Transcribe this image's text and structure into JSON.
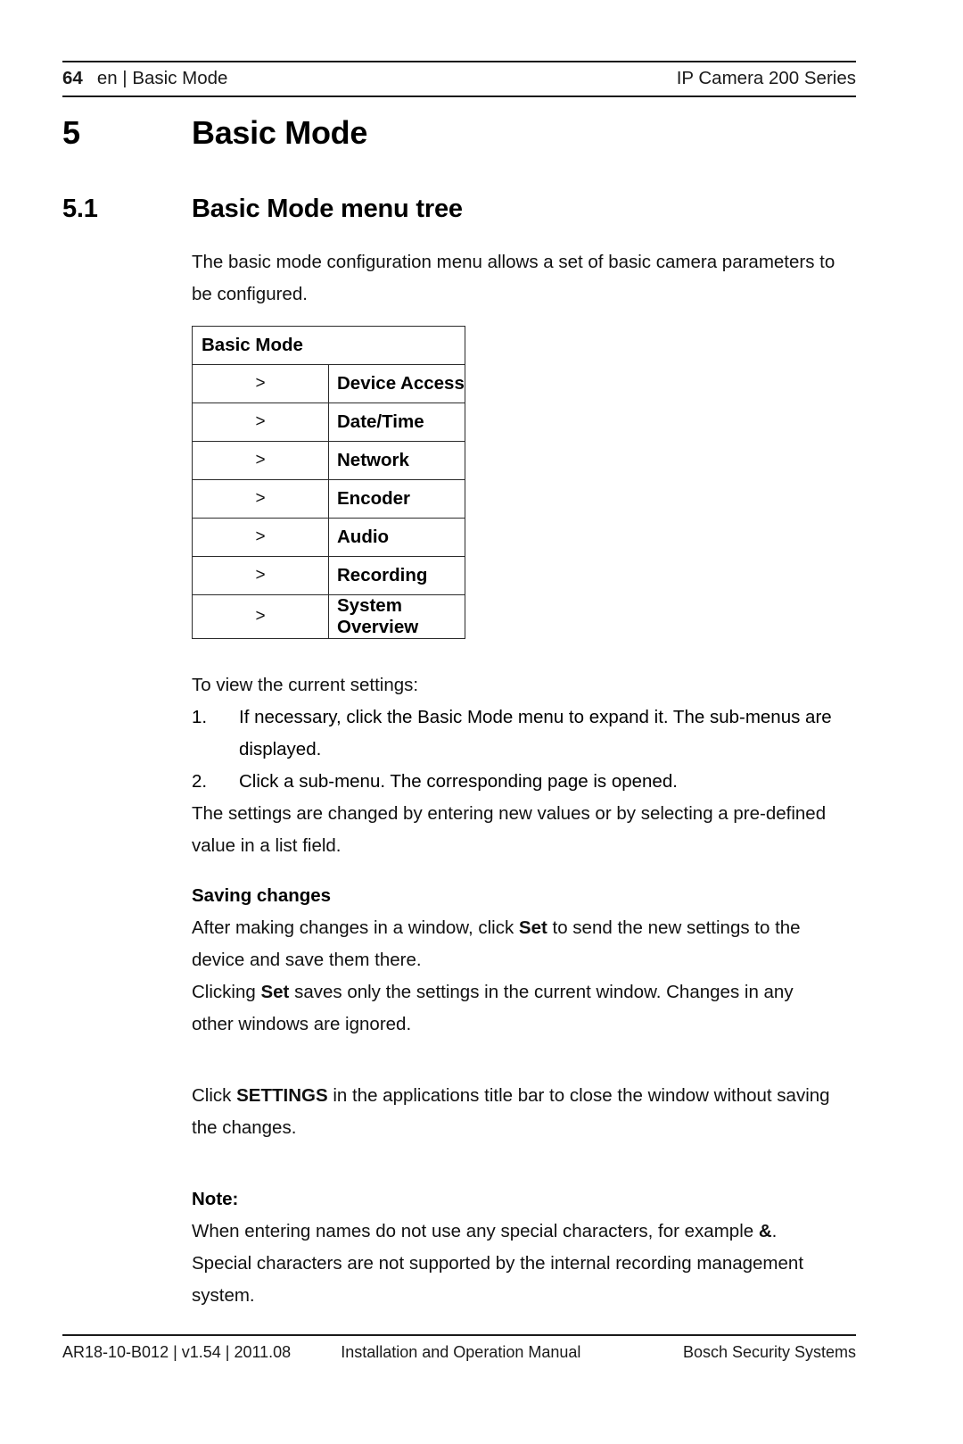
{
  "header": {
    "page_number": "64",
    "breadcrumb": "en | Basic Mode",
    "product": "IP Camera 200 Series"
  },
  "chapter": {
    "number": "5",
    "title": "Basic Mode"
  },
  "section": {
    "number": "5.1",
    "title": "Basic Mode menu tree"
  },
  "intro": {
    "paragraph": "The basic mode configuration menu allows a set of basic camera parameters to be configured."
  },
  "menu_tree": {
    "header_label": "Basic Mode",
    "arrow_glyph": ">",
    "items": [
      {
        "arrow": ">",
        "label": "Device Access"
      },
      {
        "arrow": ">",
        "label": "Date/Time"
      },
      {
        "arrow": ">",
        "label": "Network"
      },
      {
        "arrow": ">",
        "label": "Encoder"
      },
      {
        "arrow": ">",
        "label": "Audio"
      },
      {
        "arrow": ">",
        "label": "Recording"
      },
      {
        "arrow": ">",
        "label": "System Overview"
      }
    ]
  },
  "procedure": {
    "lead_in": "To view the current settings:",
    "steps": [
      {
        "marker": "1.",
        "text": "If necessary, click the Basic Mode menu to expand it. The sub-menus are displayed."
      },
      {
        "marker": "2.",
        "text": "Click a sub-menu. The corresponding page is opened."
      }
    ],
    "after_text": "The settings are changed by entering new values or by selecting a pre-defined value in a list field."
  },
  "saving_changes": {
    "heading": "Saving changes",
    "para1_before": "After making changes in a window, click ",
    "para1_bold": "Set",
    "para1_after": " to send the new settings to the device and save them there.",
    "para2_before": "Clicking ",
    "para2_bold": "Set",
    "para2_after": " saves only the settings in the current window. Changes in any other windows are ignored.",
    "para3_before": "Click ",
    "para3_bold": "SETTINGS",
    "para3_after": " in the applications title bar to close the window without saving the changes."
  },
  "note": {
    "heading": "Note:",
    "text_before": "When entering names do not use any special characters, for example ",
    "bold_char": "&",
    "text_after": ". Special characters are not supported by the internal recording management system."
  },
  "footer": {
    "doc_id": "AR18-10-B012 | v1.54 | 2011.08",
    "manual_title": "Installation and Operation Manual",
    "company": "Bosch Security Systems"
  }
}
